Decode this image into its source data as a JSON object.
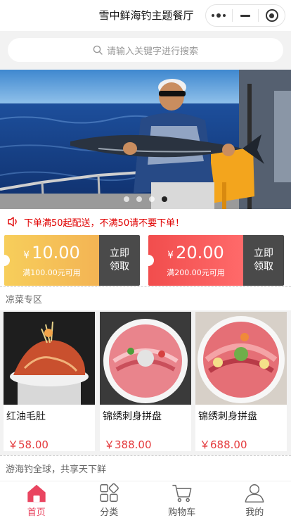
{
  "app": {
    "title": "雪中鲜海钓主题餐厅"
  },
  "search": {
    "placeholder": "请输入关键字进行搜索"
  },
  "banner": {
    "slides": 4,
    "active_index": 3
  },
  "notice": {
    "text": "下单满50起配送，不满50请不要下单！"
  },
  "coupons": [
    {
      "symbol": "¥",
      "amount": "10.00",
      "condition": "满100.00元可用",
      "claim_line1": "立即",
      "claim_line2": "领取"
    },
    {
      "symbol": "¥",
      "amount": "20.00",
      "condition": "满200.00元可用",
      "claim_line1": "立即",
      "claim_line2": "领取"
    }
  ],
  "section": {
    "title": "凉菜专区",
    "products": [
      {
        "name": "红油毛肚",
        "price": "￥58.00"
      },
      {
        "name": "锦绣刺身拼盘",
        "price": "￥388.00"
      },
      {
        "name": "锦绣刺身拼盘",
        "price": "￥688.00"
      }
    ]
  },
  "footer": {
    "text": "游海钓全球，共享天下鲜"
  },
  "tabs": [
    {
      "label": "首页",
      "icon": "home-icon",
      "active": true
    },
    {
      "label": "分类",
      "icon": "category-icon",
      "active": false
    },
    {
      "label": "购物车",
      "icon": "cart-icon",
      "active": false
    },
    {
      "label": "我的",
      "icon": "user-icon",
      "active": false
    }
  ],
  "colors": {
    "accent": "#e94560",
    "price": "#e4393c",
    "notice": "#e00000",
    "coupon1": "#f5c057",
    "coupon2": "#f25555",
    "claim_bg": "#4a4a4a"
  }
}
